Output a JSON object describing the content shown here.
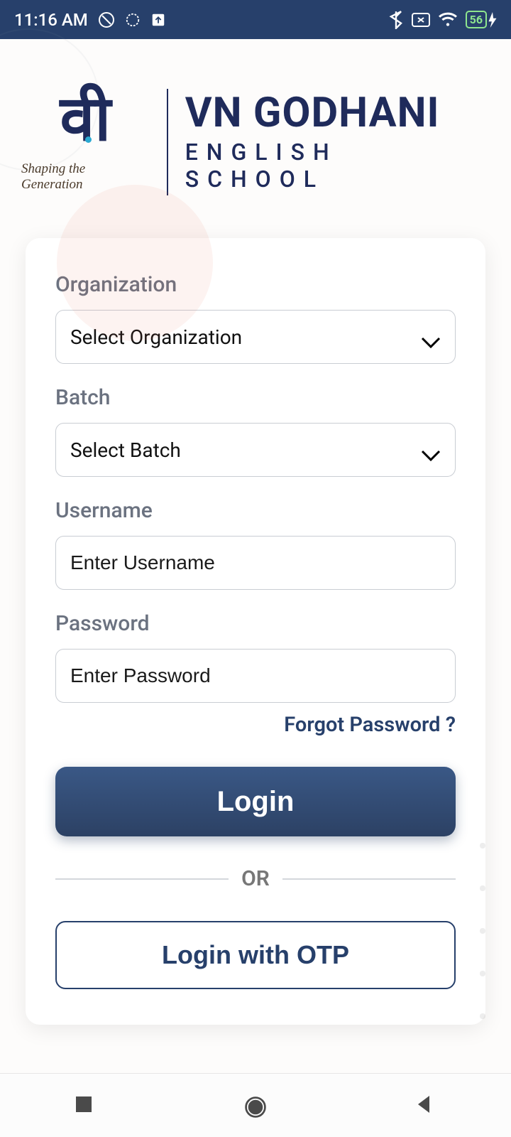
{
  "status": {
    "time": "11:16 AM",
    "battery_pct": "56"
  },
  "brand": {
    "logo_text": "वी",
    "tagline": "Shaping the Generation",
    "name_line1": "VN GODHANI",
    "name_line2": "ENGLISH  SCHOOL"
  },
  "form": {
    "organization": {
      "label": "Organization",
      "placeholder": "Select Organization"
    },
    "batch": {
      "label": "Batch",
      "placeholder": "Select Batch"
    },
    "username": {
      "label": "Username",
      "placeholder": "Enter Username"
    },
    "password": {
      "label": "Password",
      "placeholder": "Enter Password"
    },
    "forgot_label": "Forgot Password ?",
    "login_label": "Login",
    "or_label": "OR",
    "otp_label": "Login with OTP"
  },
  "colors": {
    "primary": "#27406b",
    "accent": "#2aa9d2"
  }
}
